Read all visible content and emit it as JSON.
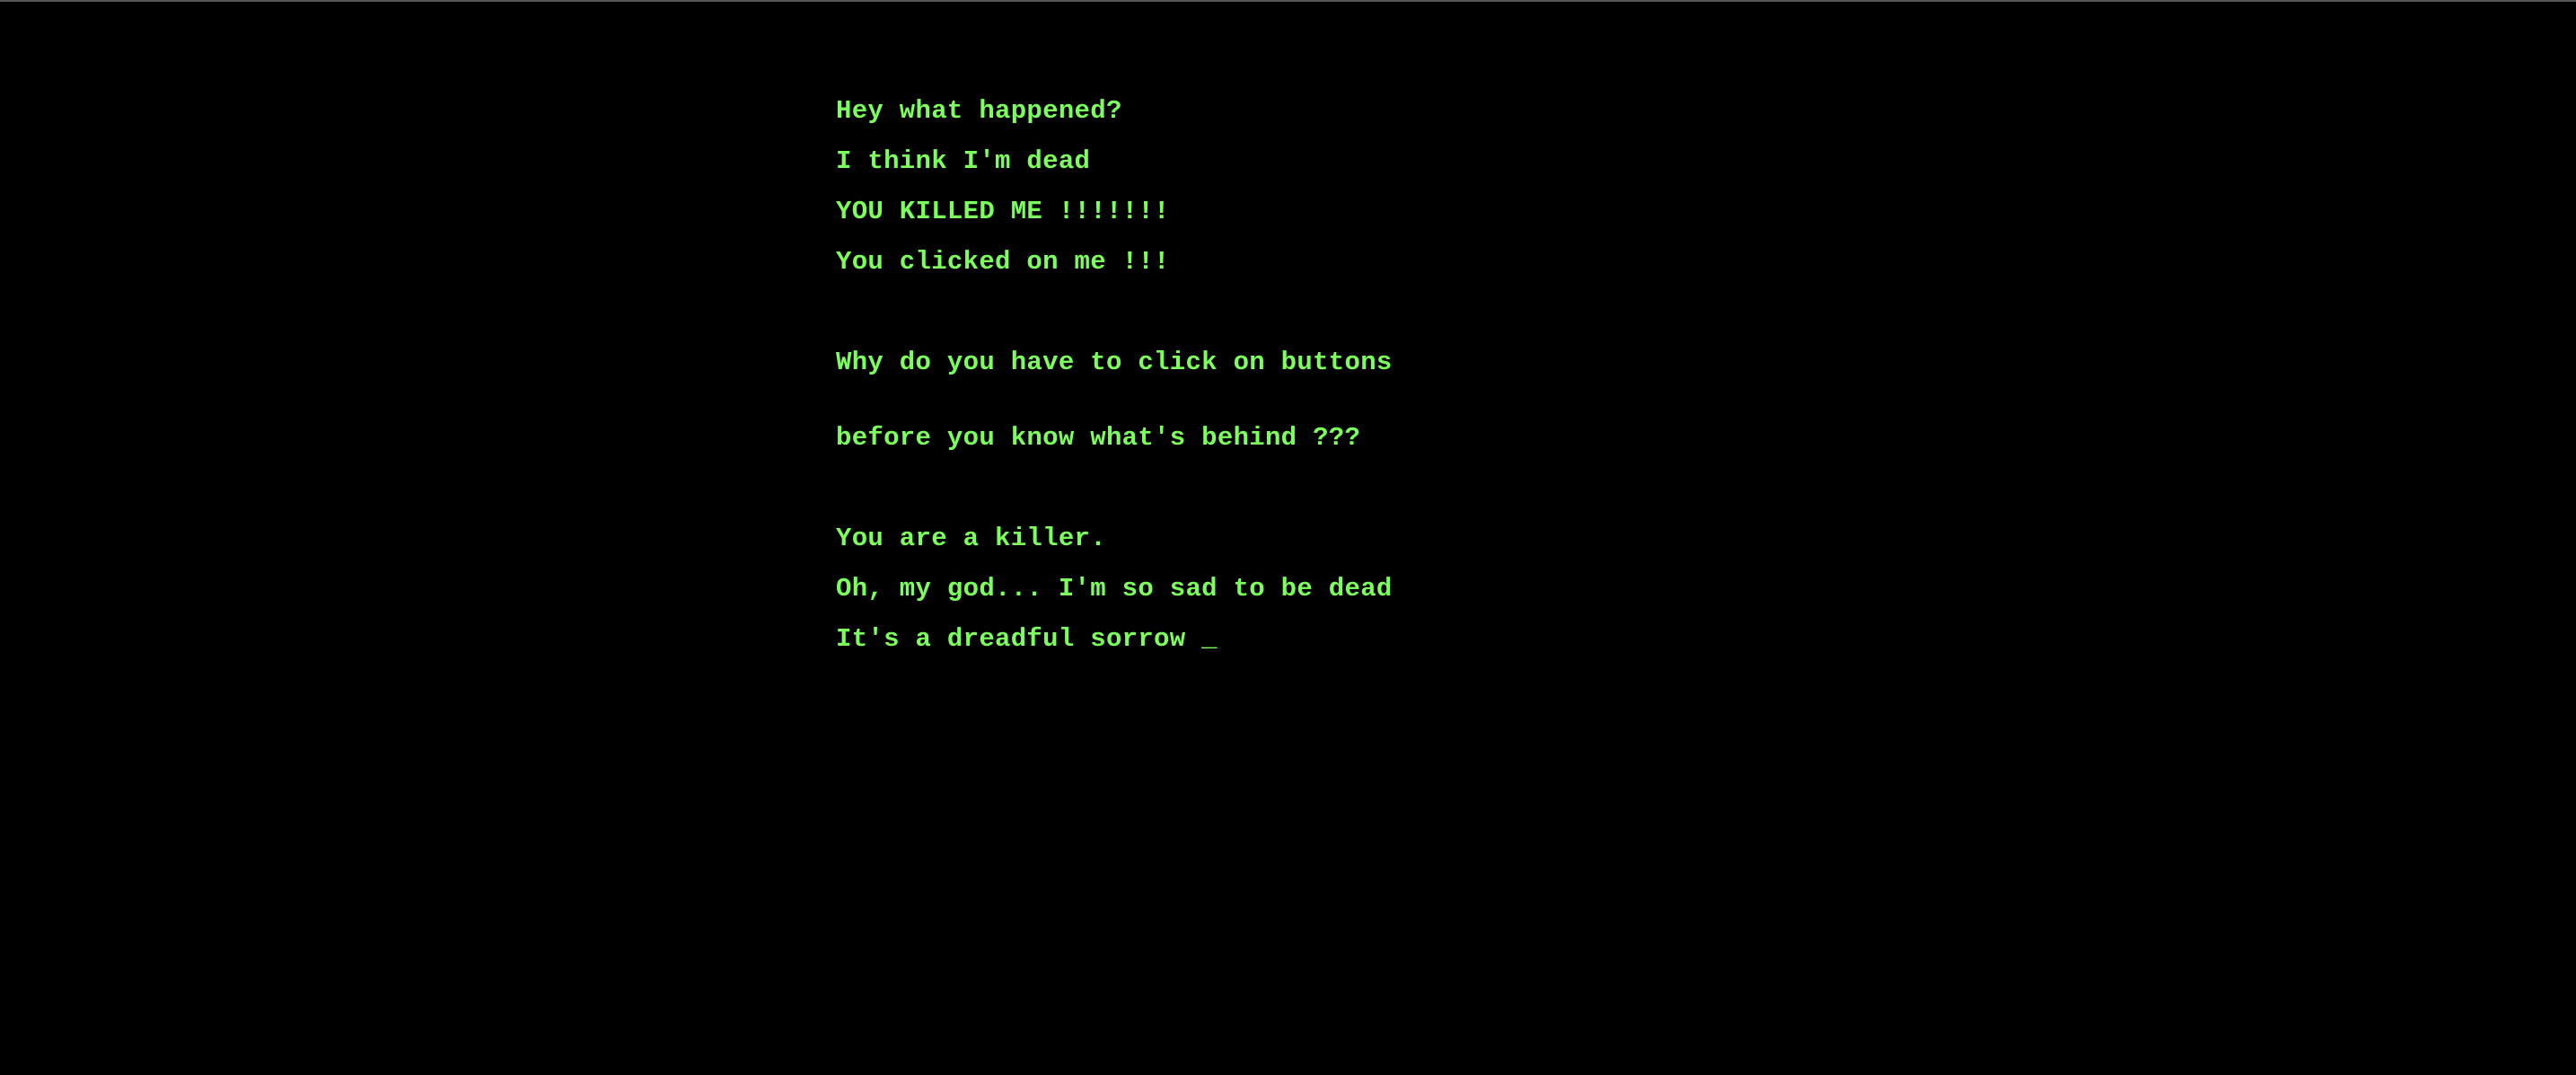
{
  "screen": {
    "background_color": "#000000",
    "text_color": "#7cff5c"
  },
  "messages": [
    "Hey what happened?",
    "I think I'm dead",
    "YOU KILLED ME !!!!!!!",
    "You clicked on me !!!",
    "Why do you have to click on buttons",
    "before you know what's behind ???",
    "You are a killer.",
    "Oh, my god... I'm so sad to be dead",
    "It's a dreadful sorrow "
  ],
  "cursor": "_"
}
